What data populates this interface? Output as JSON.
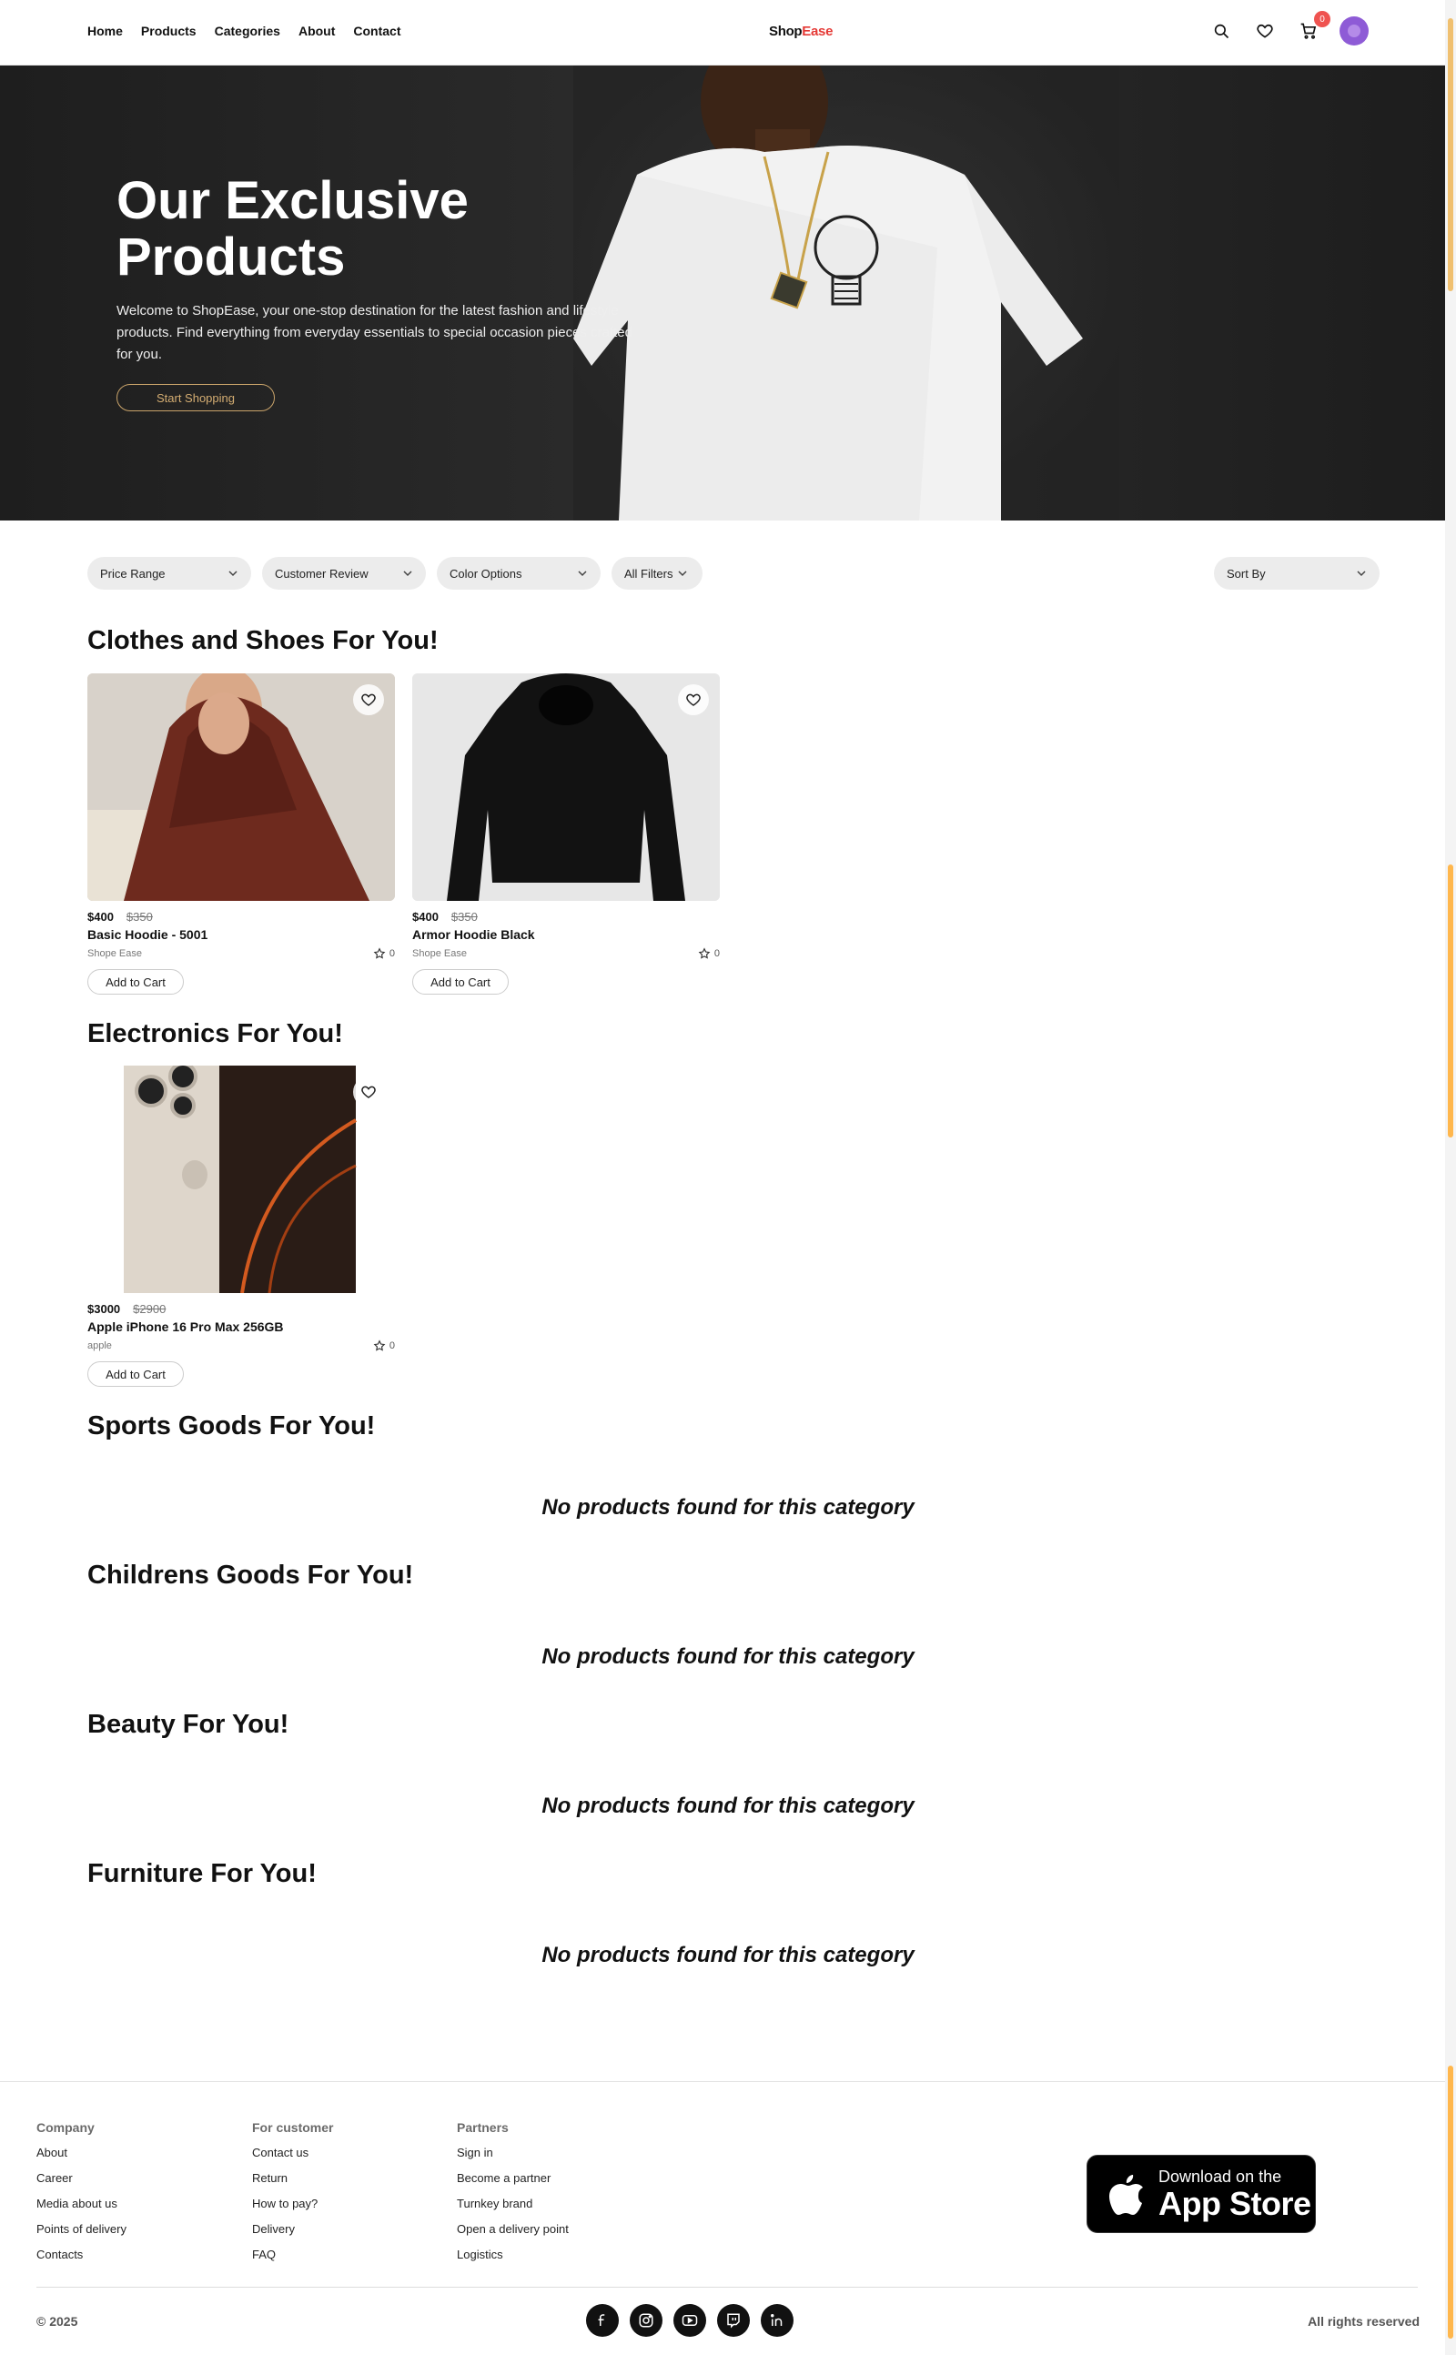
{
  "nav": {
    "links": [
      "Home",
      "Products",
      "Categories",
      "About",
      "Contact"
    ],
    "brand_part1": "Shop",
    "brand_part2": "Ease",
    "cart_count": "0",
    "icons": [
      "search-icon",
      "heart-icon",
      "cart-icon",
      "avatar"
    ]
  },
  "hero": {
    "title": "Our Exclusive Products",
    "description": "Welcome to ShopEase, your one-stop destination for the latest fashion and lifestyle products. Find everything from everyday essentials to special occasion pieces crafted for you.",
    "cta": "Start Shopping"
  },
  "filters": {
    "price_range": "Price Range",
    "customer_review": "Customer Review",
    "color_options": "Color Options",
    "all_filters": "All Filters",
    "sort_by": "Sort By"
  },
  "sections": {
    "clothes": {
      "title": "Clothes and Shoes For You!",
      "products": [
        {
          "price": "$400",
          "old_price": "$350",
          "name": "Basic Hoodie - 5001",
          "brand": "Shope Ease",
          "rating": "0",
          "button": "Add to Cart"
        },
        {
          "price": "$400",
          "old_price": "$350",
          "name": "Armor Hoodie Black",
          "brand": "Shope Ease",
          "rating": "0",
          "button": "Add to Cart"
        }
      ]
    },
    "electronics": {
      "title": "Electronics For You!",
      "products": [
        {
          "price": "$3000",
          "old_price": "$2900",
          "name": "Apple iPhone 16 Pro Max 256GB",
          "brand": "apple",
          "rating": "0",
          "button": "Add to Cart"
        }
      ]
    },
    "sports": {
      "title": "Sports Goods For You!",
      "empty": "No products found for this category"
    },
    "childrens": {
      "title": "Childrens Goods For You!",
      "empty": "No products found for this category"
    },
    "beauty": {
      "title": "Beauty For You!",
      "empty": "No products found for this category"
    },
    "furniture": {
      "title": "Furniture For You!",
      "empty": "No products found for this category"
    }
  },
  "footer": {
    "company": {
      "title": "Company",
      "items": [
        "About",
        "Career",
        "Media about us",
        "Points of delivery",
        "Contacts"
      ]
    },
    "customer": {
      "title": "For customer",
      "items": [
        "Contact us",
        "Return",
        "How to pay?",
        "Delivery",
        "FAQ"
      ]
    },
    "partners": {
      "title": "Partners",
      "items": [
        "Sign in",
        "Become a partner",
        "Turnkey brand",
        "Open a delivery point",
        "Logistics"
      ]
    },
    "appstore_line1": "Download on the",
    "appstore_line2": "App Store",
    "copyright": "© 2025",
    "rights": "All rights reserved",
    "socials": [
      "facebook-icon",
      "instagram-icon",
      "youtube-icon",
      "twitch-icon",
      "linkedin-icon"
    ]
  },
  "colors": {
    "brand_accent": "#e53935",
    "cta_gold": "#c9a36a",
    "avatar": "#8e5bd6",
    "scroll_accent": "#ffb74d"
  }
}
